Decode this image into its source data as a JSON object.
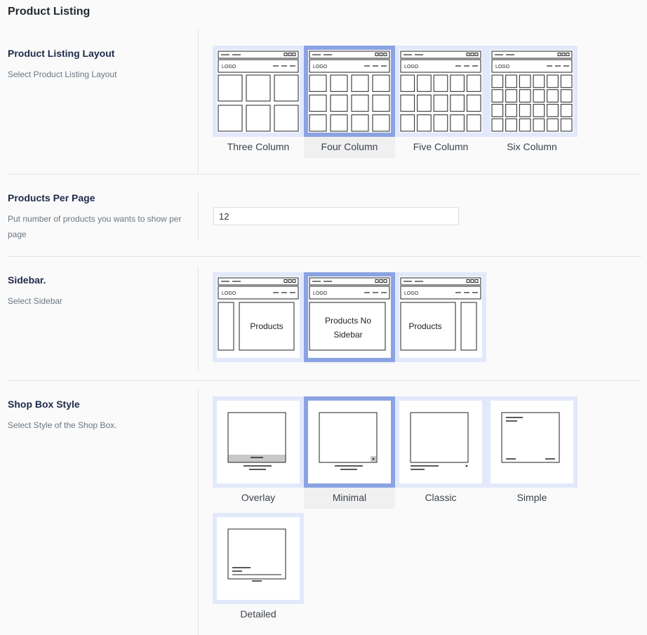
{
  "page_title": "Product Listing",
  "sections": {
    "layout": {
      "label": "Product Listing Layout",
      "desc": "Select Product Listing Layout",
      "logo_text": "LOGO",
      "selected": "Four Column",
      "options": [
        {
          "label": "Three Column",
          "columns": 3,
          "rows": 2
        },
        {
          "label": "Four Column",
          "columns": 4,
          "rows": 3
        },
        {
          "label": "Five Column",
          "columns": 5,
          "rows": 3
        },
        {
          "label": "Six Column",
          "columns": 6,
          "rows": 4
        }
      ]
    },
    "per_page": {
      "label": "Products Per Page",
      "desc": "Put number of products you wants to show per page",
      "value": "12"
    },
    "sidebar": {
      "label": "Sidebar.",
      "desc": "Select Sidebar",
      "selected": "no-sidebar",
      "options": [
        {
          "id": "left-sidebar",
          "text": "Products"
        },
        {
          "id": "no-sidebar",
          "text_line1": "Products No",
          "text_line2": "Sidebar"
        },
        {
          "id": "right-sidebar",
          "text": "Products"
        }
      ]
    },
    "shop_box": {
      "label": "Shop Box Style",
      "desc": "Select Style of the Shop Box.",
      "selected": "Minimal",
      "options": [
        {
          "label": "Overlay"
        },
        {
          "label": "Minimal"
        },
        {
          "label": "Classic"
        },
        {
          "label": "Simple"
        },
        {
          "label": "Detailed"
        }
      ]
    }
  },
  "colors": {
    "selected_border": "#8ba3e3",
    "unselected_border": "#e2e9fb",
    "heading": "#1e2a4a"
  }
}
